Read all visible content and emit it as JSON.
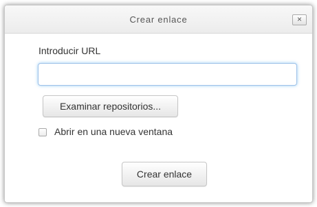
{
  "dialog": {
    "title": "Crear enlace",
    "close_label": "×"
  },
  "form": {
    "url_label": "Introducir URL",
    "url_value": "",
    "url_placeholder": "",
    "browse_button_label": "Examinar repositorios...",
    "new_window_label": "Abrir en una nueva ventana",
    "new_window_checked": false,
    "submit_label": "Crear enlace"
  }
}
